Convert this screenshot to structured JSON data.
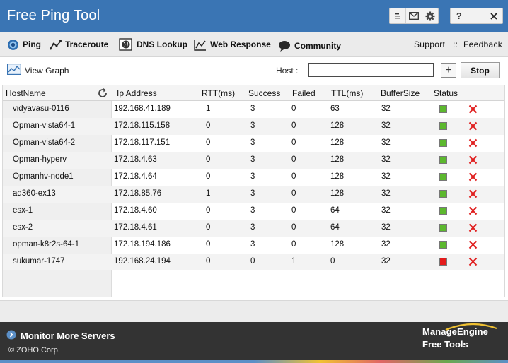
{
  "window": {
    "title": "Free Ping Tool",
    "help_label": "?",
    "minimize_label": "_",
    "close_label": "X"
  },
  "nav": {
    "ping": "Ping",
    "traceroute": "Traceroute",
    "dns_lookup": "DNS Lookup",
    "web_response": "Web Response",
    "community": "Community",
    "support": "Support",
    "separator": "::",
    "feedback": "Feedback"
  },
  "toolbar": {
    "view_graph": "View Graph",
    "host_label": "Host :",
    "host_value": "",
    "add_label": "+",
    "stop_label": "Stop"
  },
  "table": {
    "columns": [
      "HostName",
      "Ip Address",
      "RTT(ms)",
      "Success",
      "Failed",
      "TTL(ms)",
      "BufferSize",
      "Status"
    ],
    "rows": [
      {
        "host": "vidyavasu-0116",
        "ip": "192.168.41.189",
        "rtt": "1",
        "success": "3",
        "failed": "0",
        "ttl": "63",
        "buffer": "32",
        "status": "up"
      },
      {
        "host": "Opman-vista64-1",
        "ip": "172.18.115.158",
        "rtt": "0",
        "success": "3",
        "failed": "0",
        "ttl": "128",
        "buffer": "32",
        "status": "up"
      },
      {
        "host": "Opman-vista64-2",
        "ip": "172.18.117.151",
        "rtt": "0",
        "success": "3",
        "failed": "0",
        "ttl": "128",
        "buffer": "32",
        "status": "up"
      },
      {
        "host": "Opman-hyperv",
        "ip": "172.18.4.63",
        "rtt": "0",
        "success": "3",
        "failed": "0",
        "ttl": "128",
        "buffer": "32",
        "status": "up"
      },
      {
        "host": "Opmanhv-node1",
        "ip": "172.18.4.64",
        "rtt": "0",
        "success": "3",
        "failed": "0",
        "ttl": "128",
        "buffer": "32",
        "status": "up"
      },
      {
        "host": "ad360-ex13",
        "ip": "172.18.85.76",
        "rtt": "1",
        "success": "3",
        "failed": "0",
        "ttl": "128",
        "buffer": "32",
        "status": "up"
      },
      {
        "host": "esx-1",
        "ip": "172.18.4.60",
        "rtt": "0",
        "success": "3",
        "failed": "0",
        "ttl": "64",
        "buffer": "32",
        "status": "up"
      },
      {
        "host": "esx-2",
        "ip": "172.18.4.61",
        "rtt": "0",
        "success": "3",
        "failed": "0",
        "ttl": "64",
        "buffer": "32",
        "status": "up"
      },
      {
        "host": "opman-k8r2s-64-1",
        "ip": "172.18.194.186",
        "rtt": "0",
        "success": "3",
        "failed": "0",
        "ttl": "128",
        "buffer": "32",
        "status": "up"
      },
      {
        "host": "sukumar-1747",
        "ip": "192.168.24.194",
        "rtt": "0",
        "success": "0",
        "failed": "1",
        "ttl": "0",
        "buffer": "32",
        "status": "down"
      }
    ]
  },
  "status_colors": {
    "up": "#5cb82e",
    "down": "#e41b1b"
  },
  "footer": {
    "monitor_more": "Monitor More Servers",
    "copyright": "© ZOHO Corp.",
    "brand_name": "ManageEngine",
    "brand_sub": "Free Tools"
  }
}
